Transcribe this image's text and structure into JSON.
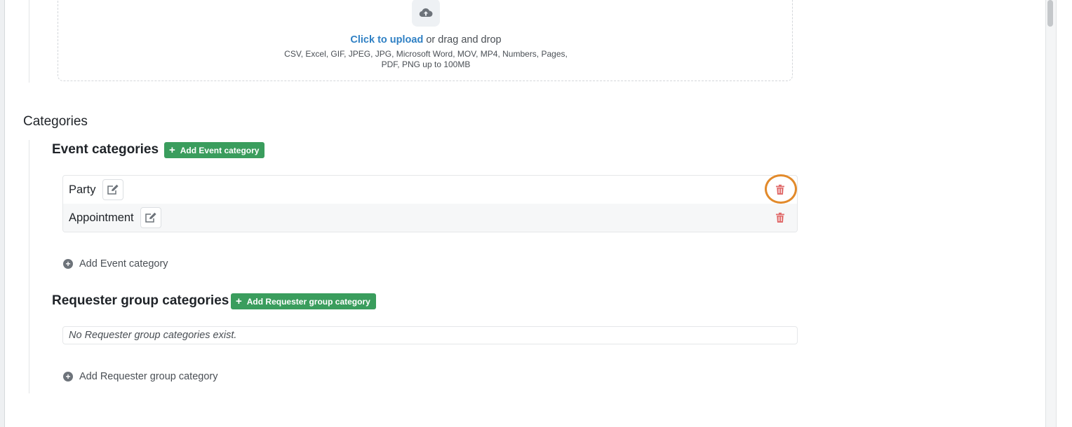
{
  "upload": {
    "link_text": "Click to upload",
    "rest_text": "or drag and drop",
    "formats_text": "CSV, Excel, GIF, JPEG, JPG, Microsoft Word, MOV, MP4, Numbers, Pages, PDF, PNG up to 100MB",
    "icon": "cloud-upload-icon"
  },
  "categories": {
    "title": "Categories",
    "event": {
      "title": "Event categories",
      "add_button": "Add Event category",
      "items": [
        {
          "label": "Party"
        },
        {
          "label": "Appointment"
        }
      ],
      "add_link": "Add Event category"
    },
    "requester": {
      "title": "Requester group categories",
      "add_button": "Add Requester group category",
      "empty_text": "No Requester group categories exist.",
      "add_link": "Add Requester group category"
    }
  },
  "colors": {
    "accent_green": "#3a9d5d",
    "link_blue": "#2f80c4",
    "delete_red": "#e06b6b",
    "highlight_orange": "#e28a2b"
  }
}
